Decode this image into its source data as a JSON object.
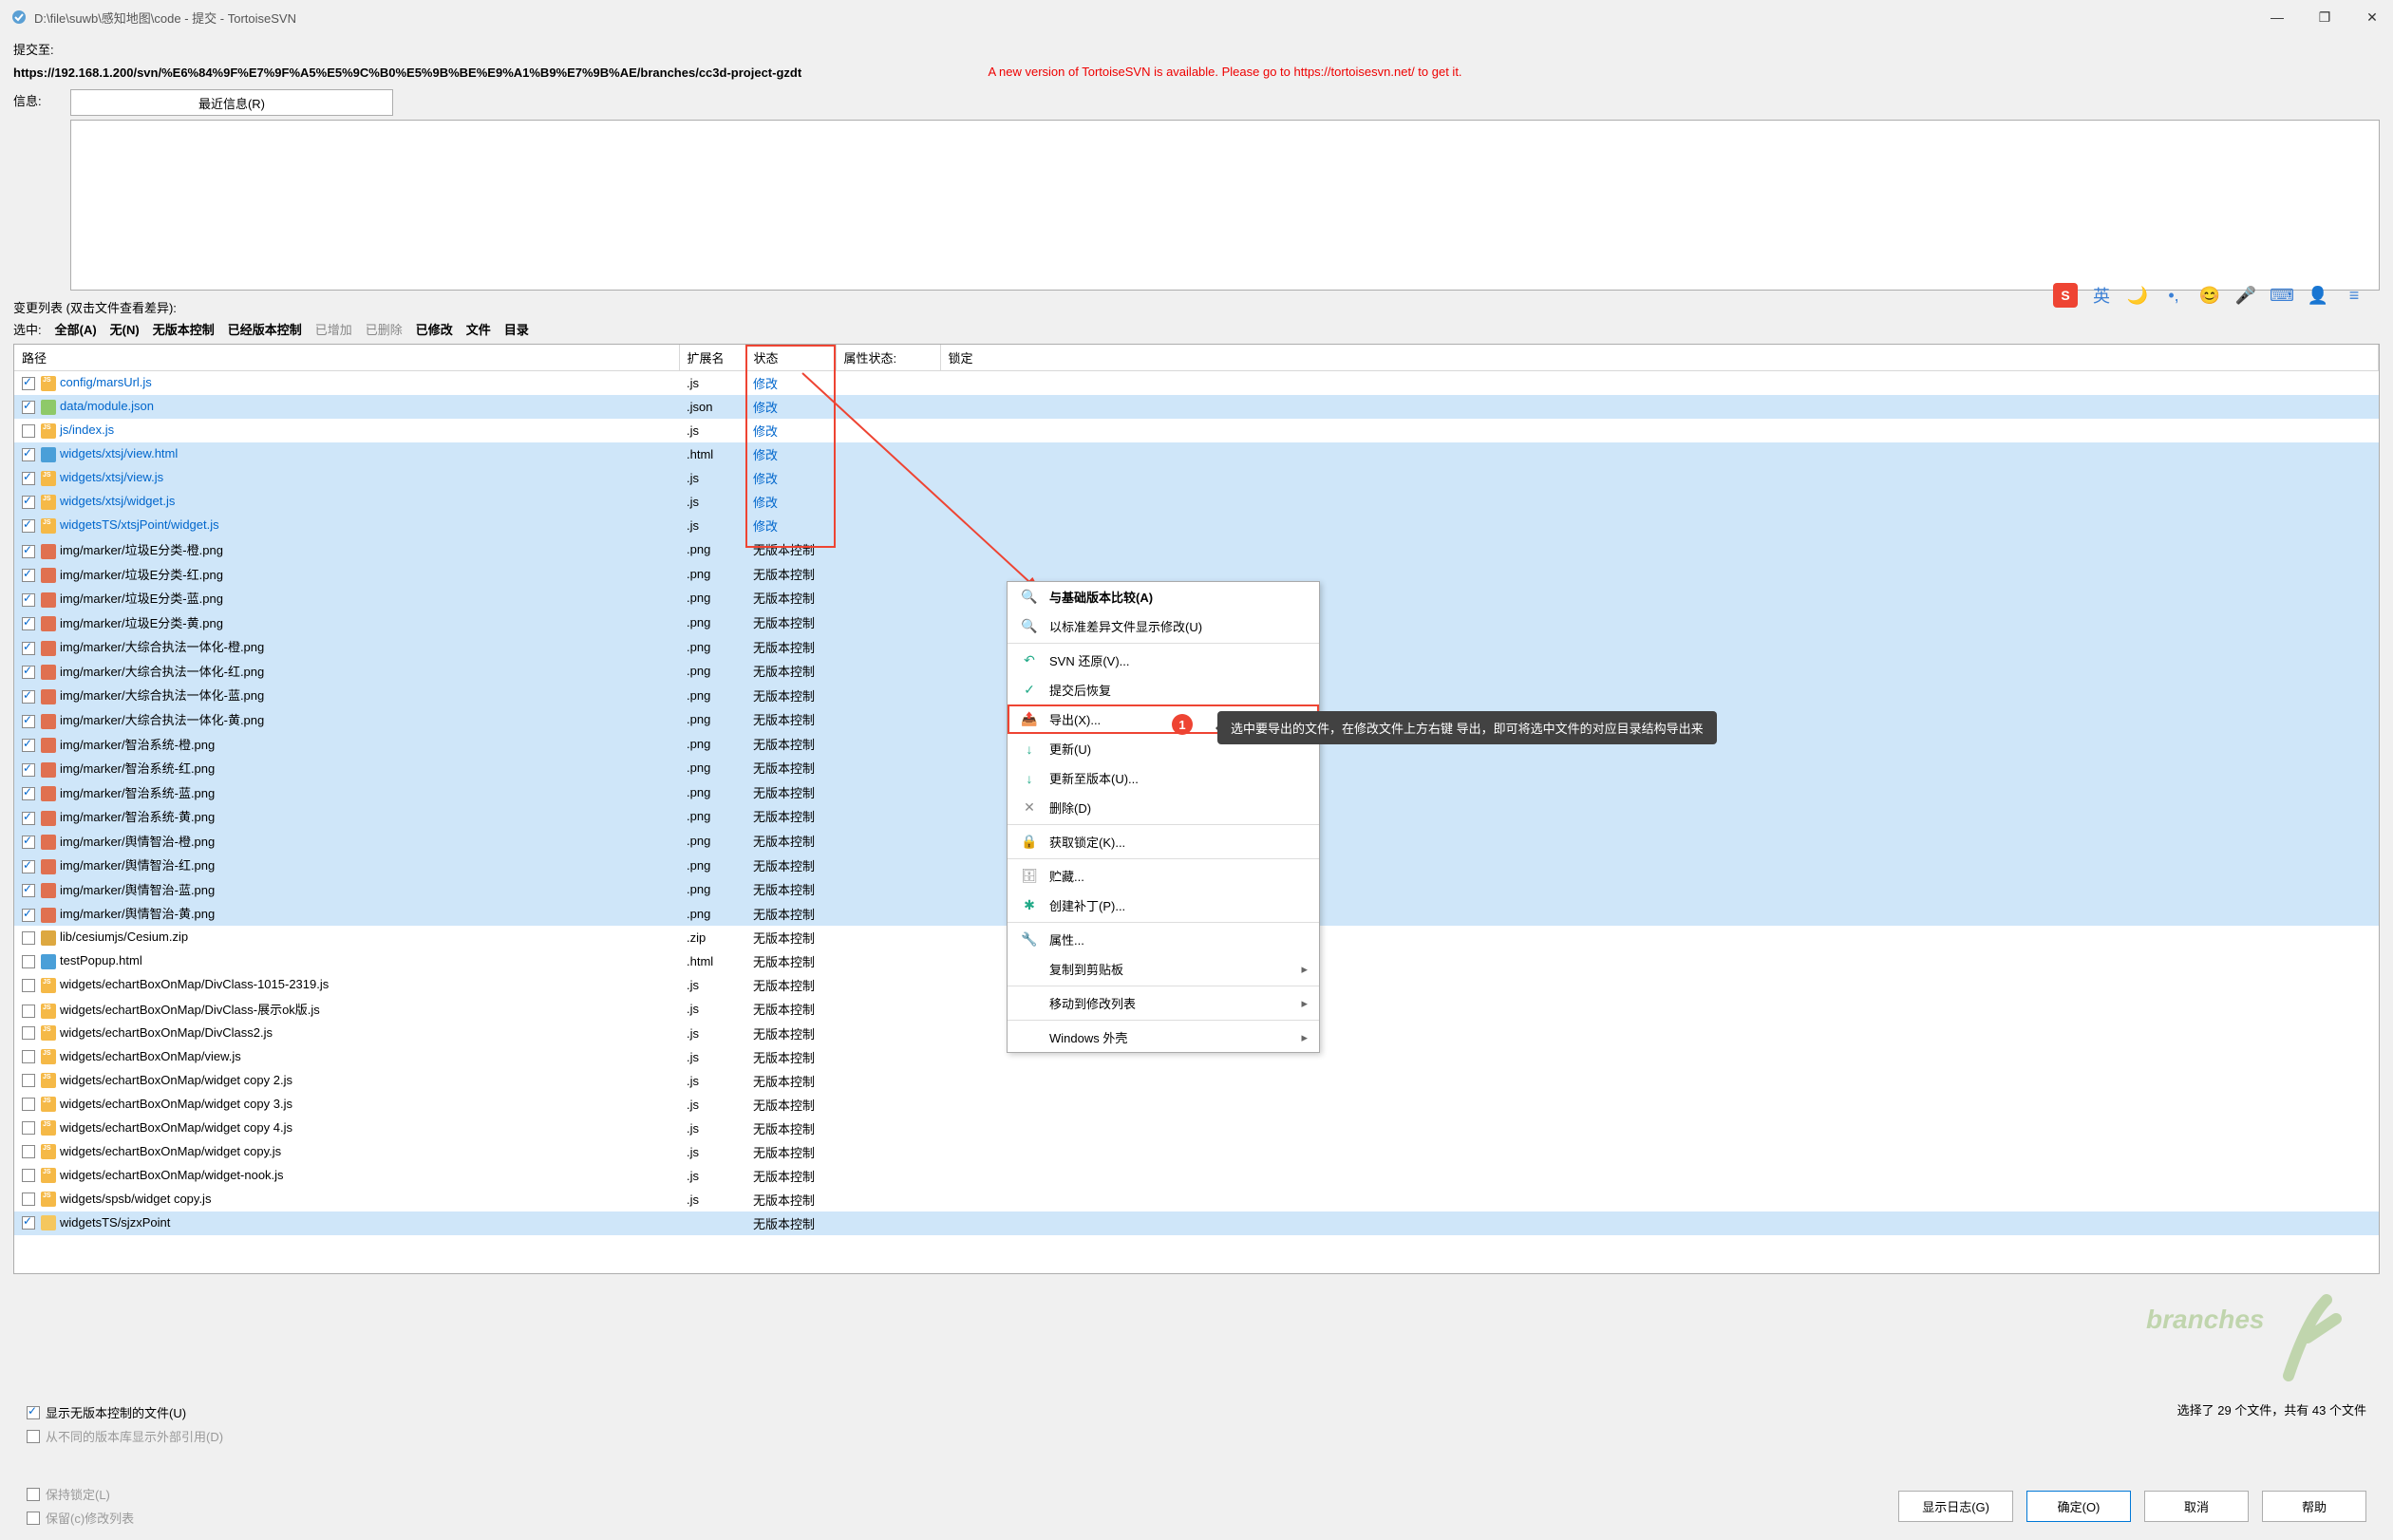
{
  "window": {
    "title": "D:\\file\\suwb\\感知地图\\code - 提交 - TortoiseSVN"
  },
  "commit_to_label": "提交至:",
  "url": "https://192.168.1.200/svn/%E6%84%9F%E7%9F%A5%E5%9C%B0%E5%9B%BE%E9%A1%B9%E7%9B%AE/branches/cc3d-project-gzdt",
  "info_label": "信息:",
  "recent_btn": "最近信息(R)",
  "update_msg": "A new version of TortoiseSVN is available. Please go to https://tortoisesvn.net/ to get it.",
  "changelist_label": "变更列表 (双击文件查看差异):",
  "filters": {
    "prefix": "选中:",
    "all": "全部(A)",
    "none": "无(N)",
    "novc": "无版本控制",
    "vc": "已经版本控制",
    "added": "已增加",
    "deleted": "已删除",
    "modified": "已修改",
    "files": "文件",
    "dirs": "目录"
  },
  "columns": {
    "path": "路径",
    "ext": "扩展名",
    "status": "状态",
    "prop": "属性状态:",
    "lock": "锁定"
  },
  "rows": [
    {
      "chk": true,
      "sel": false,
      "fi": "js",
      "path": "config/marsUrl.js",
      "ext": ".js",
      "status": "修改",
      "nov": false
    },
    {
      "chk": true,
      "sel": true,
      "fi": "json",
      "path": "data/module.json",
      "ext": ".json",
      "status": "修改",
      "nov": false
    },
    {
      "chk": false,
      "sel": false,
      "fi": "js",
      "path": "js/index.js",
      "ext": ".js",
      "status": "修改",
      "nov": false
    },
    {
      "chk": true,
      "sel": true,
      "fi": "html",
      "path": "widgets/xtsj/view.html",
      "ext": ".html",
      "status": "修改",
      "nov": false
    },
    {
      "chk": true,
      "sel": true,
      "fi": "js",
      "path": "widgets/xtsj/view.js",
      "ext": ".js",
      "status": "修改",
      "nov": false
    },
    {
      "chk": true,
      "sel": true,
      "fi": "js",
      "path": "widgets/xtsj/widget.js",
      "ext": ".js",
      "status": "修改",
      "nov": false
    },
    {
      "chk": true,
      "sel": true,
      "fi": "js",
      "path": "widgetsTS/xtsjPoint/widget.js",
      "ext": ".js",
      "status": "修改",
      "nov": false
    },
    {
      "chk": true,
      "sel": true,
      "fi": "png",
      "path": "img/marker/垃圾E分类-橙.png",
      "ext": ".png",
      "status": "无版本控制",
      "nov": true
    },
    {
      "chk": true,
      "sel": true,
      "fi": "png",
      "path": "img/marker/垃圾E分类-红.png",
      "ext": ".png",
      "status": "无版本控制",
      "nov": true
    },
    {
      "chk": true,
      "sel": true,
      "fi": "png",
      "path": "img/marker/垃圾E分类-蓝.png",
      "ext": ".png",
      "status": "无版本控制",
      "nov": true
    },
    {
      "chk": true,
      "sel": true,
      "fi": "png",
      "path": "img/marker/垃圾E分类-黄.png",
      "ext": ".png",
      "status": "无版本控制",
      "nov": true
    },
    {
      "chk": true,
      "sel": true,
      "fi": "png",
      "path": "img/marker/大综合执法一体化-橙.png",
      "ext": ".png",
      "status": "无版本控制",
      "nov": true
    },
    {
      "chk": true,
      "sel": true,
      "fi": "png",
      "path": "img/marker/大综合执法一体化-红.png",
      "ext": ".png",
      "status": "无版本控制",
      "nov": true
    },
    {
      "chk": true,
      "sel": true,
      "fi": "png",
      "path": "img/marker/大综合执法一体化-蓝.png",
      "ext": ".png",
      "status": "无版本控制",
      "nov": true
    },
    {
      "chk": true,
      "sel": true,
      "fi": "png",
      "path": "img/marker/大综合执法一体化-黄.png",
      "ext": ".png",
      "status": "无版本控制",
      "nov": true
    },
    {
      "chk": true,
      "sel": true,
      "fi": "png",
      "path": "img/marker/智治系统-橙.png",
      "ext": ".png",
      "status": "无版本控制",
      "nov": true
    },
    {
      "chk": true,
      "sel": true,
      "fi": "png",
      "path": "img/marker/智治系统-红.png",
      "ext": ".png",
      "status": "无版本控制",
      "nov": true
    },
    {
      "chk": true,
      "sel": true,
      "fi": "png",
      "path": "img/marker/智治系统-蓝.png",
      "ext": ".png",
      "status": "无版本控制",
      "nov": true
    },
    {
      "chk": true,
      "sel": true,
      "fi": "png",
      "path": "img/marker/智治系统-黄.png",
      "ext": ".png",
      "status": "无版本控制",
      "nov": true
    },
    {
      "chk": true,
      "sel": true,
      "fi": "png",
      "path": "img/marker/舆情智治-橙.png",
      "ext": ".png",
      "status": "无版本控制",
      "nov": true
    },
    {
      "chk": true,
      "sel": true,
      "fi": "png",
      "path": "img/marker/舆情智治-红.png",
      "ext": ".png",
      "status": "无版本控制",
      "nov": true
    },
    {
      "chk": true,
      "sel": true,
      "fi": "png",
      "path": "img/marker/舆情智治-蓝.png",
      "ext": ".png",
      "status": "无版本控制",
      "nov": true
    },
    {
      "chk": true,
      "sel": true,
      "fi": "png",
      "path": "img/marker/舆情智治-黄.png",
      "ext": ".png",
      "status": "无版本控制",
      "nov": true
    },
    {
      "chk": false,
      "sel": false,
      "fi": "zip",
      "path": "lib/cesiumjs/Cesium.zip",
      "ext": ".zip",
      "status": "无版本控制",
      "nov": true
    },
    {
      "chk": false,
      "sel": false,
      "fi": "html",
      "path": "testPopup.html",
      "ext": ".html",
      "status": "无版本控制",
      "nov": true
    },
    {
      "chk": false,
      "sel": false,
      "fi": "js",
      "path": "widgets/echartBoxOnMap/DivClass-1015-2319.js",
      "ext": ".js",
      "status": "无版本控制",
      "nov": true
    },
    {
      "chk": false,
      "sel": false,
      "fi": "js",
      "path": "widgets/echartBoxOnMap/DivClass-展示ok版.js",
      "ext": ".js",
      "status": "无版本控制",
      "nov": true
    },
    {
      "chk": false,
      "sel": false,
      "fi": "js",
      "path": "widgets/echartBoxOnMap/DivClass2.js",
      "ext": ".js",
      "status": "无版本控制",
      "nov": true
    },
    {
      "chk": false,
      "sel": false,
      "fi": "js",
      "path": "widgets/echartBoxOnMap/view.js",
      "ext": ".js",
      "status": "无版本控制",
      "nov": true
    },
    {
      "chk": false,
      "sel": false,
      "fi": "js",
      "path": "widgets/echartBoxOnMap/widget copy 2.js",
      "ext": ".js",
      "status": "无版本控制",
      "nov": true
    },
    {
      "chk": false,
      "sel": false,
      "fi": "js",
      "path": "widgets/echartBoxOnMap/widget copy 3.js",
      "ext": ".js",
      "status": "无版本控制",
      "nov": true
    },
    {
      "chk": false,
      "sel": false,
      "fi": "js",
      "path": "widgets/echartBoxOnMap/widget copy 4.js",
      "ext": ".js",
      "status": "无版本控制",
      "nov": true
    },
    {
      "chk": false,
      "sel": false,
      "fi": "js",
      "path": "widgets/echartBoxOnMap/widget copy.js",
      "ext": ".js",
      "status": "无版本控制",
      "nov": true
    },
    {
      "chk": false,
      "sel": false,
      "fi": "js",
      "path": "widgets/echartBoxOnMap/widget-nook.js",
      "ext": ".js",
      "status": "无版本控制",
      "nov": true
    },
    {
      "chk": false,
      "sel": false,
      "fi": "js",
      "path": "widgets/spsb/widget copy.js",
      "ext": ".js",
      "status": "无版本控制",
      "nov": true
    },
    {
      "chk": true,
      "sel": true,
      "fi": "folder",
      "path": "widgetsTS/sjzxPoint",
      "ext": "",
      "status": "无版本控制",
      "nov": true
    }
  ],
  "context_menu": [
    {
      "icon": "🔍",
      "label": "与基础版本比较(A)",
      "bold": true
    },
    {
      "icon": "🔍",
      "label": "以标准差异文件显示修改(U)"
    },
    {
      "sep": true
    },
    {
      "icon": "↶",
      "label": "SVN 还原(V)...",
      "color": "#2a8"
    },
    {
      "icon": "✓",
      "label": "提交后恢复",
      "color": "#2a8"
    },
    {
      "icon": "📤",
      "label": "导出(X)...",
      "color": "#2a8",
      "hl": true
    },
    {
      "icon": "↓",
      "label": "更新(U)",
      "color": "#2a8"
    },
    {
      "icon": "↓",
      "label": "更新至版本(U)...",
      "color": "#2a8"
    },
    {
      "icon": "✕",
      "label": "删除(D)",
      "color": "#888"
    },
    {
      "sep": true
    },
    {
      "icon": "🔒",
      "label": "获取锁定(K)...",
      "color": "#c80"
    },
    {
      "sep": true
    },
    {
      "icon": "🗄",
      "label": "贮藏...",
      "color": "#888"
    },
    {
      "icon": "✱",
      "label": "创建补丁(P)...",
      "color": "#2a8"
    },
    {
      "sep": true
    },
    {
      "icon": "🔧",
      "label": "属性...",
      "color": "#888"
    },
    {
      "icon": "",
      "label": "复制到剪贴板",
      "arrow": true
    },
    {
      "sep": true
    },
    {
      "icon": "",
      "label": "移动到修改列表",
      "arrow": true
    },
    {
      "sep": true
    },
    {
      "icon": "",
      "label": "Windows 外壳",
      "arrow": true
    }
  ],
  "badge_num": "1",
  "tooltip_text": "选中要导出的文件，在修改文件上方右键 导出，即可将选中文件的对应目录结构导出来",
  "footer": {
    "show_unversioned": "显示无版本控制的文件(U)",
    "show_externals": "从不同的版本库显示外部引用(D)",
    "keep_locks": "保持锁定(L)",
    "keep_changelist": "保留(c)修改列表",
    "selection_status": "选择了 29 个文件，共有 43 个文件"
  },
  "buttons": {
    "show_log": "显示日志(G)",
    "ok": "确定(O)",
    "cancel": "取消",
    "help": "帮助"
  },
  "watermark": "branches"
}
